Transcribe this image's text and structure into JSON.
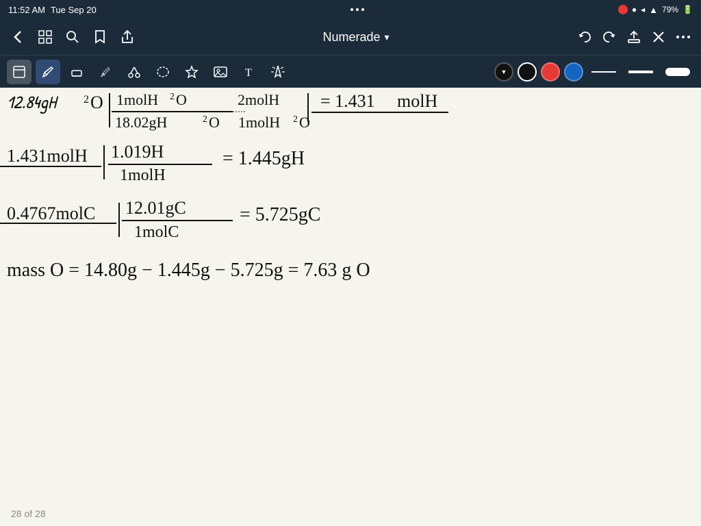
{
  "statusBar": {
    "time": "11:52 AM",
    "date": "Tue Sep 20",
    "dots": "···",
    "battery": "79%",
    "recording": true
  },
  "navBar": {
    "title": "Numerade",
    "dropdown_arrow": "▾",
    "back_label": "‹",
    "grid_label": "⊞",
    "search_label": "⌕",
    "bookmark_label": "🔖",
    "share_label": "↑",
    "undo_label": "↩",
    "redo_label": "↪",
    "save_label": "↑",
    "close_label": "✕",
    "more_label": "···"
  },
  "toolbar": {
    "tools": [
      {
        "name": "layers",
        "icon": "⊡"
      },
      {
        "name": "pen",
        "icon": "✏"
      },
      {
        "name": "eraser",
        "icon": "◻"
      },
      {
        "name": "highlighter",
        "icon": "✏"
      },
      {
        "name": "cut",
        "icon": "✂"
      },
      {
        "name": "lasso",
        "icon": "⊙"
      },
      {
        "name": "star",
        "icon": "★"
      },
      {
        "name": "image",
        "icon": "⊞"
      },
      {
        "name": "text",
        "icon": "T"
      },
      {
        "name": "pointer",
        "icon": "⊘"
      }
    ],
    "colors": [
      {
        "name": "black",
        "hex": "#111111",
        "selected": true
      },
      {
        "name": "red",
        "hex": "#e53935"
      },
      {
        "name": "blue",
        "hex": "#1565C0"
      }
    ],
    "strokes": [
      {
        "name": "thin",
        "height": 2
      },
      {
        "name": "medium",
        "height": 4
      },
      {
        "name": "thick",
        "height": 10
      }
    ]
  },
  "content": {
    "lines": [
      "12.84gH₂O | 1molH₂O  2molH  = 1.431molH",
      "           18.02gH₂O | 1molH₂O",
      "1.431molH | 1.019H   = 1.445gH",
      "           1molH",
      "0.4767molC | 12.01gC  = 5.725gC",
      "            1molC",
      "mass O = 14.80g - 1.445g - 5.725g = 7.63 g O"
    ]
  },
  "bottomBar": {
    "page_count": "28 of 28"
  }
}
